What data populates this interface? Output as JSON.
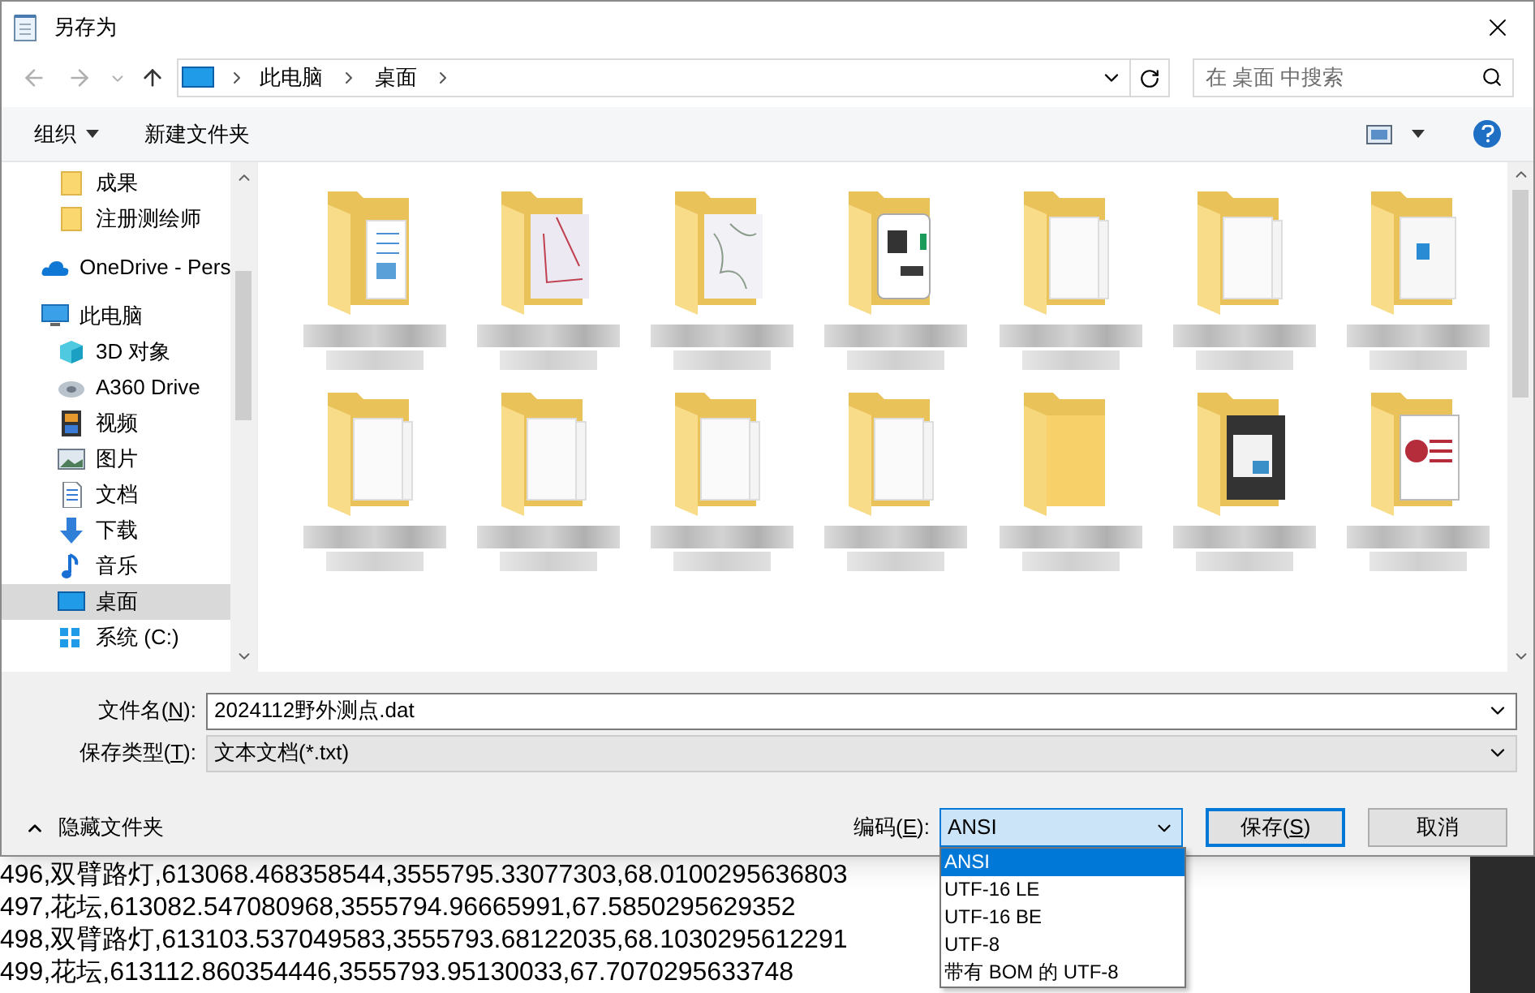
{
  "window": {
    "title": "另存为"
  },
  "address_bar": {
    "breadcrumbs": [
      "此电脑",
      "桌面"
    ]
  },
  "search": {
    "placeholder": "在 桌面 中搜索"
  },
  "toolbar": {
    "organize": "组织",
    "new_folder": "新建文件夹"
  },
  "sidebar": {
    "pinned_folders": [
      {
        "label": "成果",
        "selected": false
      },
      {
        "label": "注册测绘师",
        "selected": false
      }
    ],
    "items": [
      {
        "label": "OneDrive - Pers",
        "kind": "cloud",
        "selected": false
      },
      {
        "label": "此电脑",
        "kind": "pc",
        "selected": false,
        "children": [
          {
            "label": "3D 对象",
            "kind": "cube",
            "selected": false
          },
          {
            "label": "A360 Drive",
            "kind": "drive",
            "selected": false
          },
          {
            "label": "视频",
            "kind": "video",
            "selected": false
          },
          {
            "label": "图片",
            "kind": "picture",
            "selected": false
          },
          {
            "label": "文档",
            "kind": "document",
            "selected": false
          },
          {
            "label": "下载",
            "kind": "download",
            "selected": false
          },
          {
            "label": "音乐",
            "kind": "music",
            "selected": false
          },
          {
            "label": "桌面",
            "kind": "desktop",
            "selected": true
          },
          {
            "label": "系统 (C:)",
            "kind": "disk",
            "selected": false
          }
        ]
      }
    ]
  },
  "files": [
    {
      "kind": "image-doc"
    },
    {
      "kind": "map"
    },
    {
      "kind": "sketch"
    },
    {
      "kind": "kmz"
    },
    {
      "kind": "papers"
    },
    {
      "kind": "papers"
    },
    {
      "kind": "word"
    },
    {
      "kind": "papers"
    },
    {
      "kind": "papers"
    },
    {
      "kind": "papers"
    },
    {
      "kind": "papers"
    },
    {
      "kind": "empty"
    },
    {
      "kind": "slide"
    },
    {
      "kind": "access"
    }
  ],
  "file_name": {
    "label": "文件名(",
    "access_key": "N",
    "label_end": "):",
    "value": "2024112野外测点.dat"
  },
  "file_type": {
    "label": "保存类型(",
    "access_key": "T",
    "label_end": "):",
    "value": "文本文档(*.txt)"
  },
  "hide_folders": "隐藏文件夹",
  "encoding": {
    "label": "编码(",
    "access_key": "E",
    "label_end": "):",
    "value": "ANSI",
    "expanded": true,
    "options": [
      {
        "label": "ANSI",
        "selected": true
      },
      {
        "label": "UTF-16 LE",
        "selected": false
      },
      {
        "label": "UTF-16 BE",
        "selected": false
      },
      {
        "label": "UTF-8",
        "selected": false
      },
      {
        "label": "带有 BOM 的 UTF-8",
        "selected": false
      }
    ]
  },
  "buttons": {
    "save": {
      "label": "保存(",
      "access_key": "S",
      "label_end": ")"
    },
    "cancel": {
      "label": "取消"
    }
  },
  "background_text": [
    "496,双臂路灯,613068.468358544,3555795.33077303,68.0100295636803",
    "497,花坛,613082.547080968,3555794.96665991,67.5850295629352",
    "498,双臂路灯,613103.537049583,3555793.68122035,68.1030295612291",
    "499,花坛,613112.860354446,3555793.95130033,67.7070295633748"
  ]
}
